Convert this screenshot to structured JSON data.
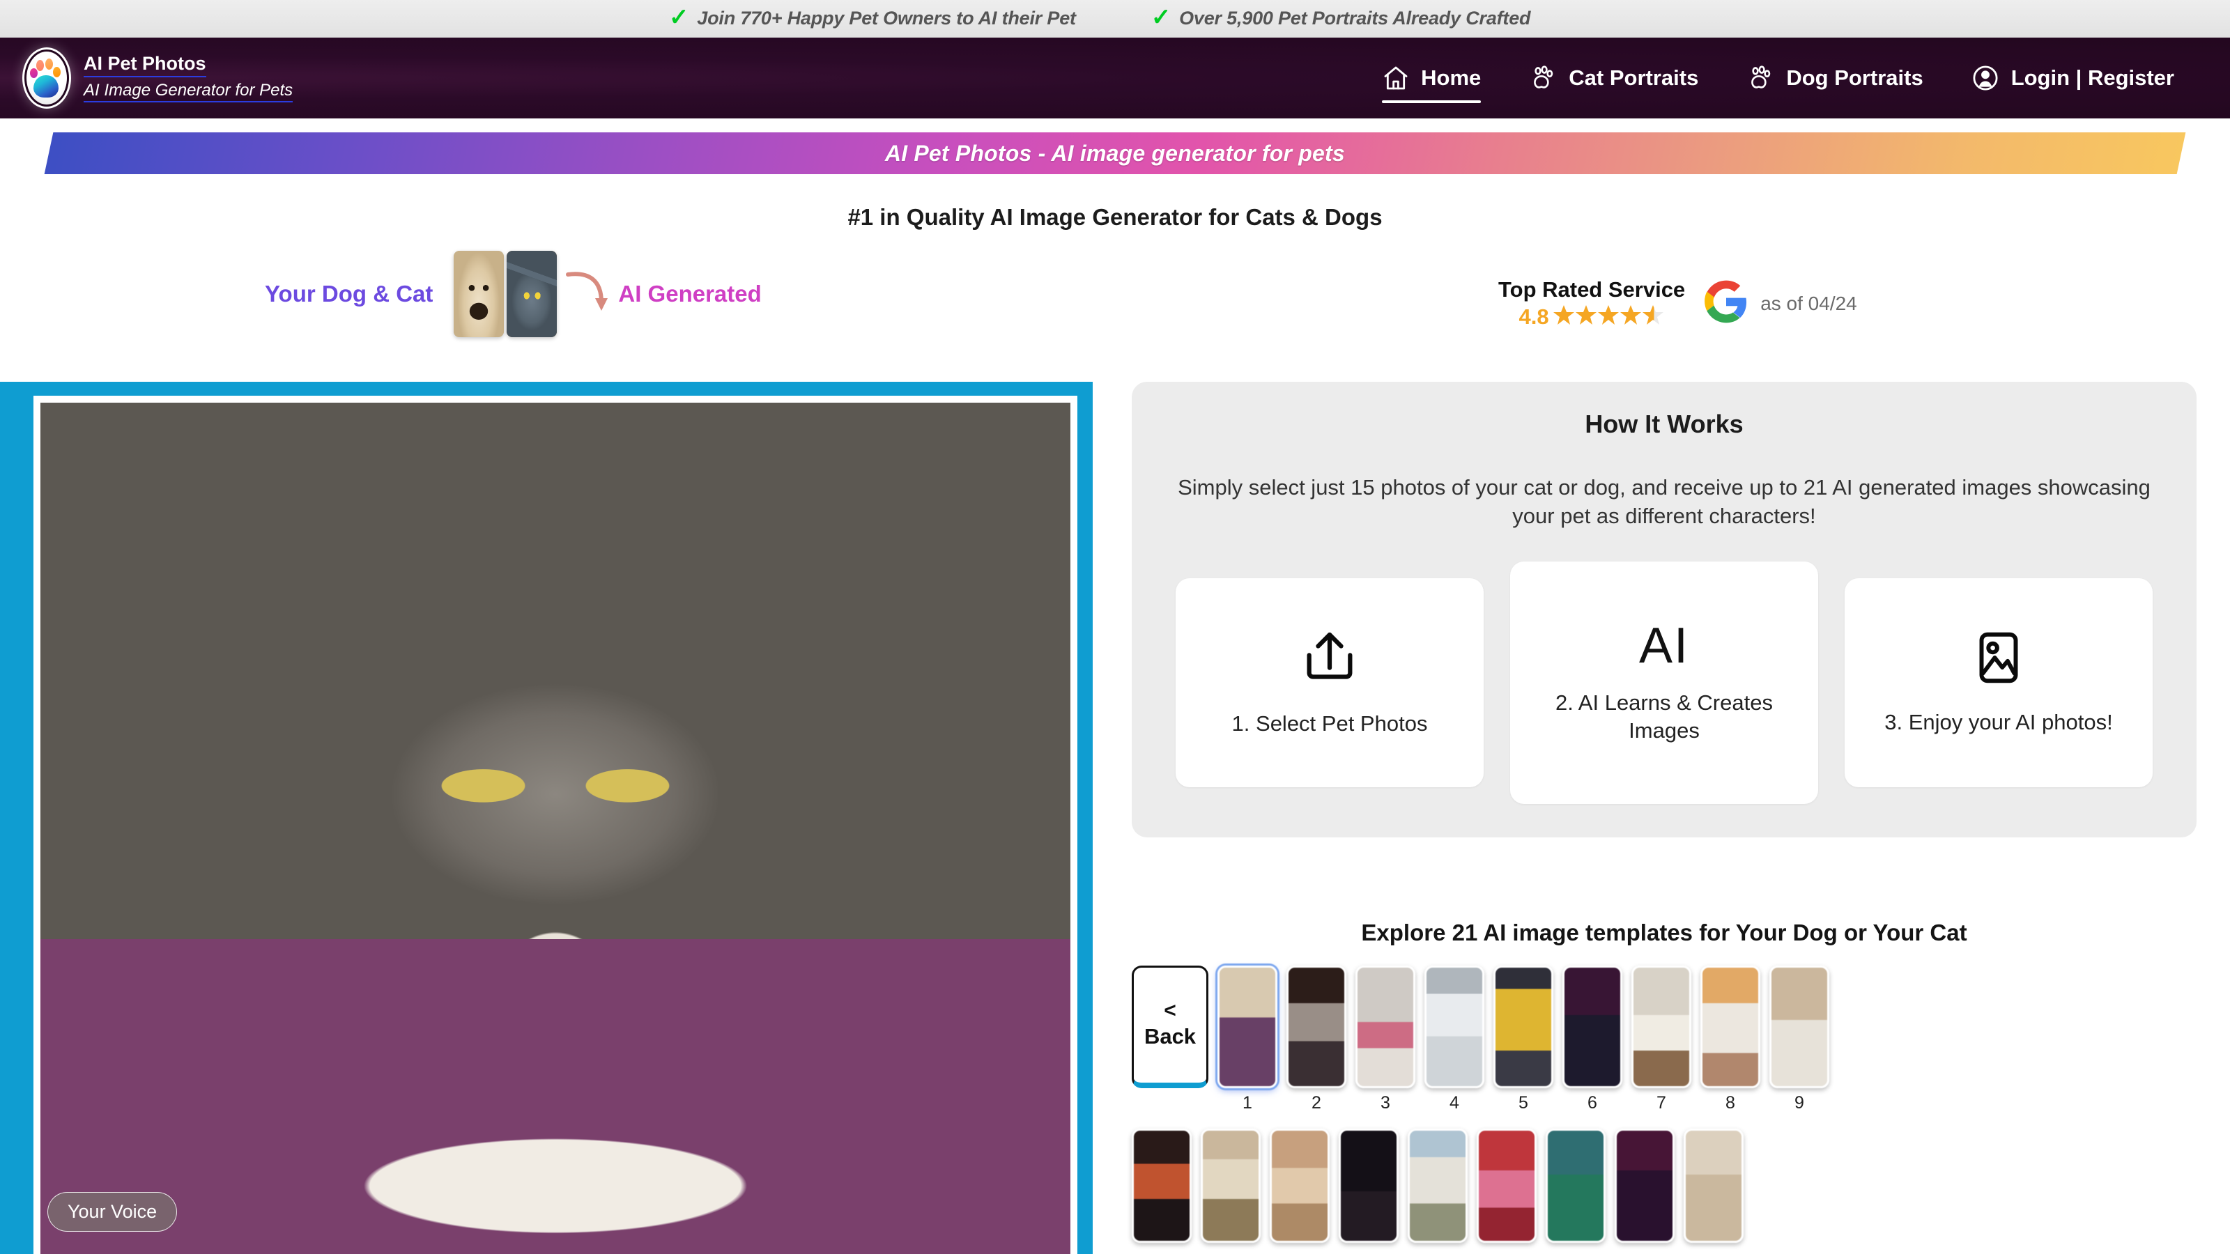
{
  "topbar": {
    "items": [
      {
        "icon": "check-icon",
        "text": "Join 770+ Happy Pet Owners to AI their Pet"
      },
      {
        "icon": "check-icon",
        "text": "Over 5,900 Pet Portraits Already Crafted"
      }
    ]
  },
  "brand": {
    "logo_icon": "paw-logo-icon",
    "name": "AI Pet Photos",
    "tagline": "AI Image Generator for Pets"
  },
  "nav": {
    "items": [
      {
        "label": "Home",
        "icon": "home-icon",
        "active": true
      },
      {
        "label": "Cat Portraits",
        "icon": "paw-icon",
        "active": false
      },
      {
        "label": "Dog Portraits",
        "icon": "paw-icon",
        "active": false
      },
      {
        "label": "Login | Register",
        "icon": "user-circle-icon",
        "active": false
      }
    ]
  },
  "ribbon": {
    "text": "AI Pet Photos - AI image generator for pets",
    "gradient_start": "#3d4fc4",
    "gradient_end": "#f8c75f"
  },
  "headline": "#1 in Quality AI Image Generator for Cats & Dogs",
  "before_after": {
    "left_label": "Your Dog & Cat",
    "right_label": "AI Generated",
    "arrow_icon": "curved-arrow-icon",
    "left_color": "#6c4ae0",
    "right_color": "#cf3fc4",
    "thumbs": [
      {
        "name": "dog-photo-thumb"
      },
      {
        "name": "cat-photo-thumb"
      }
    ]
  },
  "rating": {
    "title": "Top Rated Service",
    "score": "4.8",
    "stars": "★★★★",
    "half_star": "half-star-icon",
    "provider_icon": "google-logo-icon",
    "date": "as of 04/24",
    "star_color": "#f5a623"
  },
  "hero": {
    "image_name": "ai-generated-cat-in-purple-suit",
    "voice_badge": "Your Voice",
    "frame_color": "#0f9dd1"
  },
  "how_it_works": {
    "title": "How It Works",
    "subtitle": "Simply select just 15 photos of your cat or dog, and receive up to 21 AI generated images showcasing your pet as different characters!",
    "cards": [
      {
        "icon": "upload-icon",
        "label": "1. Select Pet Photos"
      },
      {
        "icon": "ai-text-icon",
        "glyph": "AI",
        "label": "2. AI Learns & Creates Images"
      },
      {
        "icon": "image-icon",
        "label": "3. Enjoy your AI photos!"
      }
    ]
  },
  "templates": {
    "title": "Explore 21 AI image templates for Your Dog or Your Cat",
    "back_button": {
      "chevron": "<",
      "label": "Back",
      "icon": "chevron-left-icon"
    },
    "row1": [
      {
        "num": "1",
        "selected": true,
        "name": "cat-in-purple-suit-cafe"
      },
      {
        "num": "2",
        "selected": false,
        "name": "dog-in-fur-hat-bar"
      },
      {
        "num": "3",
        "selected": false,
        "name": "cat-in-pink-street"
      },
      {
        "num": "4",
        "selected": false,
        "name": "cat-astronaut"
      },
      {
        "num": "5",
        "selected": false,
        "name": "dog-in-yellow-suit"
      },
      {
        "num": "6",
        "selected": false,
        "name": "cat-rockstar-neon"
      },
      {
        "num": "7",
        "selected": false,
        "name": "cat-chef-restaurant"
      },
      {
        "num": "8",
        "selected": false,
        "name": "cat-in-winter-village"
      },
      {
        "num": "9",
        "selected": false,
        "name": "template-nine"
      }
    ],
    "row2": [
      {
        "num": "",
        "selected": false,
        "name": "cat-superhero-fire"
      },
      {
        "num": "",
        "selected": false,
        "name": "dog-cowboy"
      },
      {
        "num": "",
        "selected": false,
        "name": "dog-desert-runner"
      },
      {
        "num": "",
        "selected": false,
        "name": "cat-dark-throne"
      },
      {
        "num": "",
        "selected": false,
        "name": "dog-suit-palace"
      },
      {
        "num": "",
        "selected": false,
        "name": "dog-pink-suit-red-room"
      },
      {
        "num": "",
        "selected": false,
        "name": "cat-green-armor"
      },
      {
        "num": "",
        "selected": false,
        "name": "cat-purple-warrior"
      },
      {
        "num": "",
        "selected": false,
        "name": "dog-red-cape-hero"
      }
    ]
  }
}
